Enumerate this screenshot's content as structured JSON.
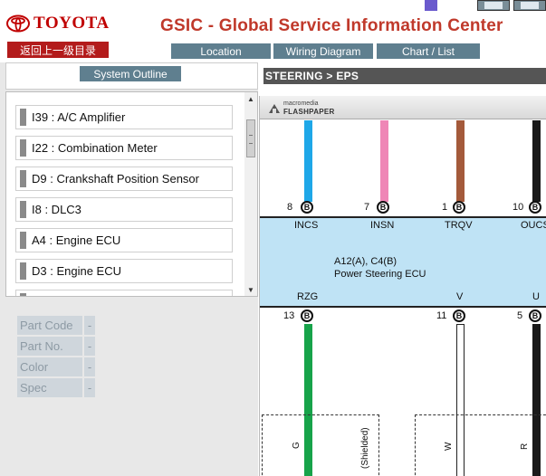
{
  "header": {
    "brand": "TOYOTA",
    "title": "GSIC - Global Service Information Center",
    "back_label": "返回上一级目录"
  },
  "nav": {
    "location_label": "Location",
    "wiring_label": "Wiring Diagram",
    "chart_label": "Chart / List"
  },
  "sidebar": {
    "outline_label": "System Outline",
    "items": [
      {
        "label": "I39 : A/C Amplifier"
      },
      {
        "label": "I22 : Combination Meter"
      },
      {
        "label": "D9 : Crankshaft Position Sensor"
      },
      {
        "label": "I8 : DLC3"
      },
      {
        "label": "A4 : Engine ECU"
      },
      {
        "label": "D3 : Engine ECU"
      }
    ]
  },
  "details": [
    {
      "label": "Part Code",
      "value": "-"
    },
    {
      "label": "Part No.",
      "value": "-"
    },
    {
      "label": "Color",
      "value": "-"
    },
    {
      "label": "Spec",
      "value": "-"
    }
  ],
  "breadcrumb": "STEERING > EPS",
  "viewer": {
    "brand_top": "macromedia",
    "brand_main": "FLASHPAPER"
  },
  "diagram": {
    "ecu_name": "A12(A), C4(B)",
    "ecu_desc": "Power Steering ECU",
    "top_pins": [
      {
        "num": "8",
        "letter": "B",
        "signal": "INCS",
        "color": "#1ea7e8"
      },
      {
        "num": "7",
        "letter": "B",
        "signal": "INSN",
        "color": "#ef86b6"
      },
      {
        "num": "1",
        "letter": "B",
        "signal": "TRQV",
        "color": "#a45a3b"
      },
      {
        "num": "10",
        "letter": "B",
        "signal": "OUCS",
        "color": "#1a1a1a"
      }
    ],
    "bottom_pins": [
      {
        "num": "13",
        "letter": "B",
        "signal": "RZG",
        "wire_label": "G",
        "color": "#17a34a"
      },
      {
        "num": "11",
        "letter": "B",
        "signal": "V",
        "wire_label": "W",
        "color": "#ffffff"
      },
      {
        "num": "5",
        "letter": "B",
        "signal": "U",
        "wire_label": "R",
        "color": "#1a1a1a"
      }
    ],
    "shielded_label": "(Shielded)"
  },
  "colors": {
    "brand_red": "#c00000",
    "title_red": "#c0392b",
    "nav_button": "#5f7f8f",
    "back_button": "#b31b1b",
    "ecu_fill": "#bfe3f5"
  }
}
